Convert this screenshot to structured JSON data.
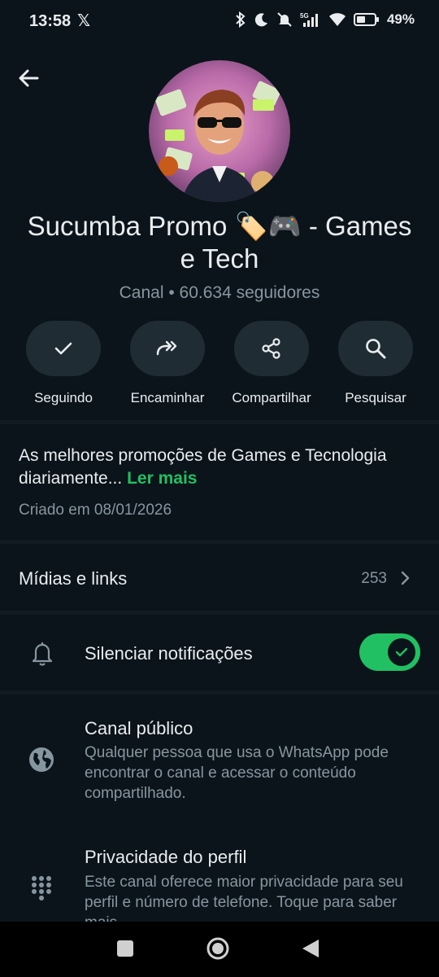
{
  "status_bar": {
    "time": "13:58",
    "x_logo": "𝕏",
    "battery": "49%"
  },
  "channel": {
    "name_line1": "Sucumba Promo 🏷️🎮  - Games",
    "name_line2": "e Tech",
    "meta": "Canal • 60.634 seguidores"
  },
  "actions": [
    {
      "label": "Seguindo",
      "icon": "check-icon"
    },
    {
      "label": "Encaminhar",
      "icon": "forward-icon"
    },
    {
      "label": "Compartilhar",
      "icon": "share-icon"
    },
    {
      "label": "Pesquisar",
      "icon": "search-icon"
    }
  ],
  "description": {
    "text": "As melhores promoções de Games e Tecnologia diariamente...",
    "read_more": "Ler mais",
    "created": "Criado em 08/01/2026"
  },
  "media": {
    "label": "Mídias e links",
    "count": "253"
  },
  "mute": {
    "label": "Silenciar notificações",
    "enabled": true
  },
  "public_channel": {
    "title": "Canal público",
    "body": "Qualquer pessoa que usa o WhatsApp pode encontrar o canal e acessar o conteúdo compartilhado."
  },
  "profile_privacy": {
    "title": "Privacidade do perfil",
    "body": "Este canal oferece maior privacidade para seu perfil e número de telefone. Toque para saber mais."
  },
  "colors": {
    "background": "#0b141a",
    "accent_green": "#21c063",
    "button_bg": "#202c33",
    "secondary_text": "#8696a0"
  }
}
